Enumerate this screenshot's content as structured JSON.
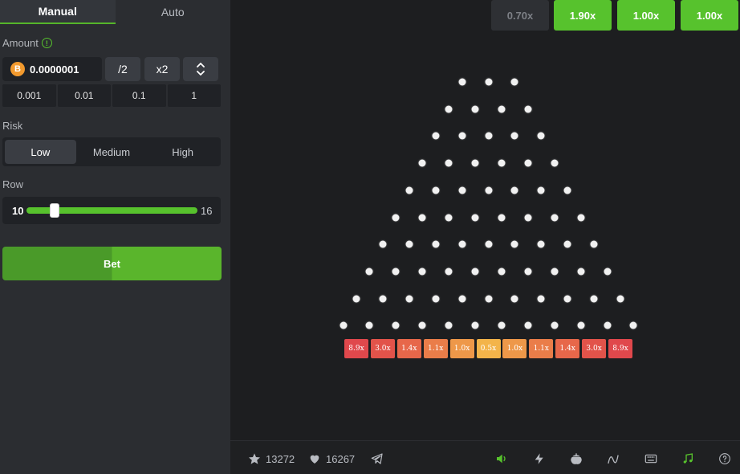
{
  "tabs": [
    {
      "label": "Manual",
      "active": true
    },
    {
      "label": "Auto",
      "active": false
    }
  ],
  "amount": {
    "label": "Amount",
    "info_icon": "info-icon",
    "currency_icon": "bitcoin-icon",
    "currency_symbol": "B",
    "value": "0.0000001",
    "half_label": "/2",
    "double_label": "x2",
    "quick_values": [
      "0.001",
      "0.01",
      "0.1",
      "1"
    ]
  },
  "risk": {
    "label": "Risk",
    "options": [
      "Low",
      "Medium",
      "High"
    ],
    "selected": "Low"
  },
  "row": {
    "label": "Row",
    "min": "10",
    "max": "16",
    "value": 11
  },
  "bet_label": "Bet",
  "history": [
    {
      "label": "0.70x",
      "win": false
    },
    {
      "label": "1.90x",
      "win": true
    },
    {
      "label": "1.00x",
      "win": true
    },
    {
      "label": "1.00x",
      "win": true
    }
  ],
  "slots": [
    {
      "label": "8.9x",
      "color": "#e0484c"
    },
    {
      "label": "3.0x",
      "color": "#e2534a"
    },
    {
      "label": "1.4x",
      "color": "#e7674a"
    },
    {
      "label": "1.1x",
      "color": "#ea7d49"
    },
    {
      "label": "1.0x",
      "color": "#ee9849"
    },
    {
      "label": "0.5x",
      "color": "#f3b44a"
    },
    {
      "label": "1.0x",
      "color": "#ee9849"
    },
    {
      "label": "1.1x",
      "color": "#ea7d49"
    },
    {
      "label": "1.4x",
      "color": "#e7674a"
    },
    {
      "label": "3.0x",
      "color": "#e2534a"
    },
    {
      "label": "8.9x",
      "color": "#e0484c"
    }
  ],
  "footer": {
    "favorites_count": "13272",
    "likes_count": "16267",
    "icons": [
      "star-icon",
      "heart-icon",
      "telegram-icon",
      "sound-icon",
      "lightning-icon",
      "acorn-icon",
      "curve-icon",
      "keyboard-icon",
      "music-icon",
      "help-icon"
    ]
  },
  "colors": {
    "accent": "#57c22d",
    "sidebar_bg": "#2b2d31",
    "board_bg": "#1d1e20"
  }
}
